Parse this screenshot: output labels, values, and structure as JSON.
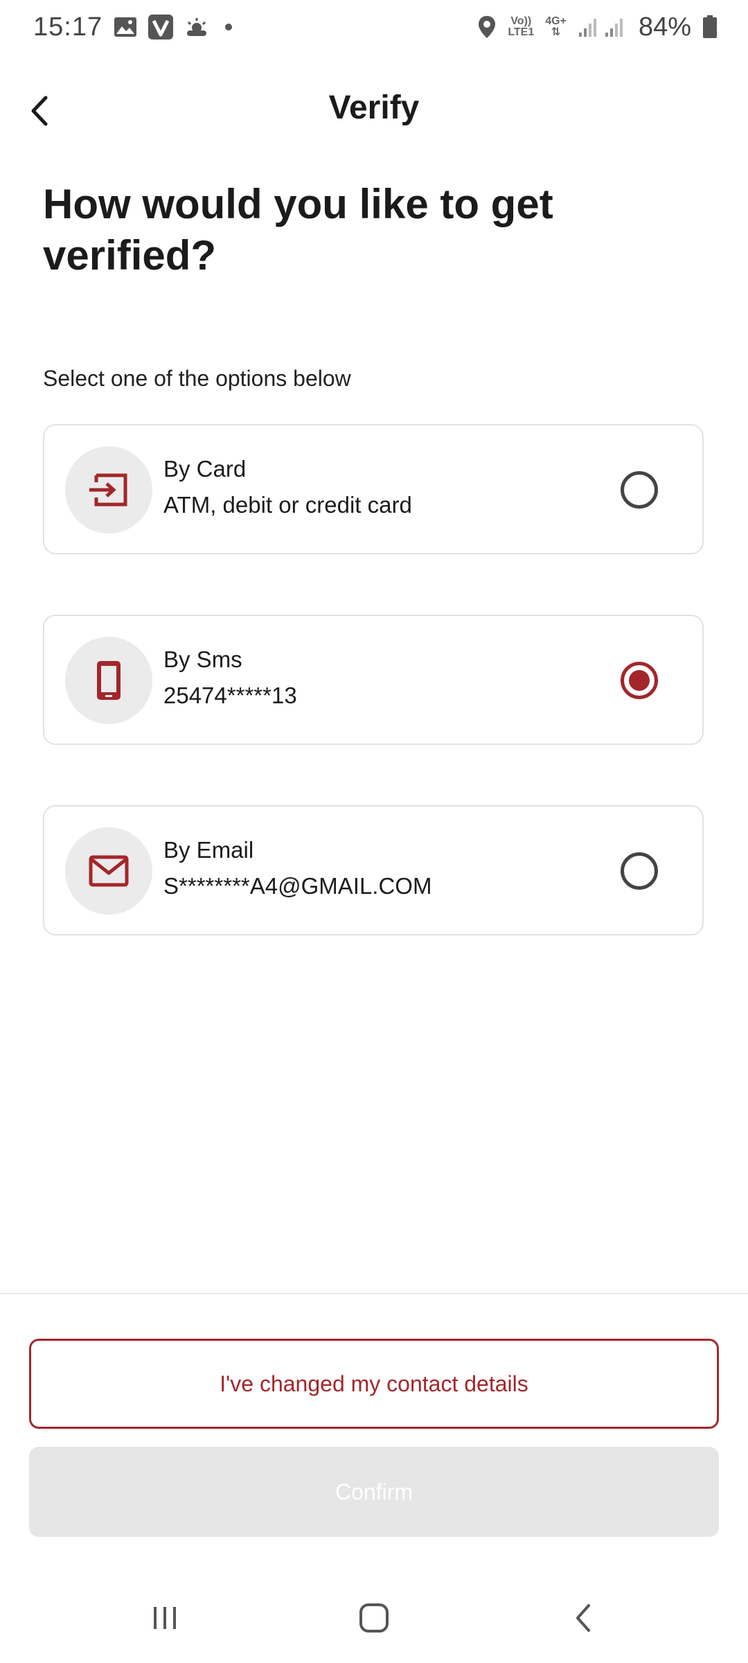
{
  "status_bar": {
    "time": "15:17",
    "network_top": "Vo))",
    "network_bottom": "LTE1",
    "network_type": "4G+",
    "battery": "84%",
    "icons": [
      "gallery-icon",
      "v-app-icon",
      "weather-icon",
      "dot-icon",
      "location-icon",
      "signal-icon",
      "battery-icon"
    ]
  },
  "header": {
    "title": "Verify",
    "back_icon": "chevron-left-icon"
  },
  "question": "How would you like to get verified?",
  "instructions": "Select one of the options below",
  "options": [
    {
      "title": "By Card",
      "subtitle": "ATM, debit or credit card",
      "icon": "card-icon",
      "selected": false
    },
    {
      "title": "By Sms",
      "subtitle": "25474*****13",
      "icon": "phone-icon",
      "selected": true
    },
    {
      "title": "By Email",
      "subtitle": "S********A4@GMAIL.COM",
      "icon": "mail-icon",
      "selected": false
    }
  ],
  "buttons": {
    "changed_contact": "I've changed my contact details",
    "confirm": "Confirm"
  },
  "nav_bar": {
    "icons": [
      "recent-apps-icon",
      "home-icon",
      "back-icon"
    ]
  },
  "colors": {
    "accent": "#a3262a",
    "icon_bg": "#ebebeb",
    "card_border": "#e2e2e2",
    "disabled_button": "#e6e6e6"
  }
}
